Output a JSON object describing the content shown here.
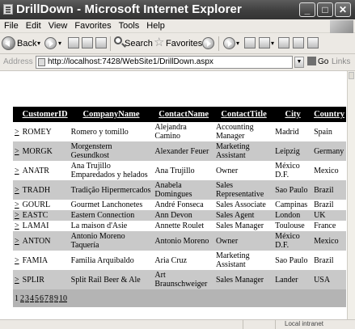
{
  "window": {
    "title": "DrillDown - Microsoft Internet Explorer"
  },
  "menu": [
    "File",
    "Edit",
    "View",
    "Favorites",
    "Tools",
    "Help"
  ],
  "toolbar": {
    "back_label": "Back",
    "search_label": "Search",
    "favorites_label": "Favorites"
  },
  "address": {
    "label": "Address",
    "url": "http://localhost:7428/WebSite1/DrillDown.aspx",
    "go_label": "Go",
    "links_label": "Links"
  },
  "status": {
    "zone": "Local intranet"
  },
  "grid": {
    "columns": [
      "CustomerID",
      "CompanyName",
      "ContactName",
      "ContactTitle",
      "City",
      "Country"
    ],
    "select_glyph": ">",
    "rows": [
      {
        "id": "ROMEY",
        "company": "Romero y tomillo",
        "contact": "Alejandra Camino",
        "title": "Accounting Manager",
        "city": "Madrid",
        "country": "Spain"
      },
      {
        "id": "MORGK",
        "company": "Morgenstern Gesundkost",
        "contact": "Alexander Feuer",
        "title": "Marketing Assistant",
        "city": "Leipzig",
        "country": "Germany"
      },
      {
        "id": "ANATR",
        "company": "Ana Trujillo Emparedados y helados",
        "contact": "Ana Trujillo",
        "title": "Owner",
        "city": "México D.F.",
        "country": "Mexico"
      },
      {
        "id": "TRADH",
        "company": "Tradição Hipermercados",
        "contact": "Anabela Domingues",
        "title": "Sales Representative",
        "city": "Sao Paulo",
        "country": "Brazil"
      },
      {
        "id": "GOURL",
        "company": "Gourmet Lanchonetes",
        "contact": "André Fonseca",
        "title": "Sales Associate",
        "city": "Campinas",
        "country": "Brazil"
      },
      {
        "id": "EASTC",
        "company": "Eastern Connection",
        "contact": "Ann Devon",
        "title": "Sales Agent",
        "city": "London",
        "country": "UK"
      },
      {
        "id": "LAMAI",
        "company": "La maison d'Asie",
        "contact": "Annette Roulet",
        "title": "Sales Manager",
        "city": "Toulouse",
        "country": "France"
      },
      {
        "id": "ANTON",
        "company": "Antonio Moreno Taquería",
        "contact": "Antonio Moreno",
        "title": "Owner",
        "city": "México D.F.",
        "country": "Mexico"
      },
      {
        "id": "FAMIA",
        "company": "Familia Arquibaldo",
        "contact": "Aria Cruz",
        "title": "Marketing Assistant",
        "city": "Sao Paulo",
        "country": "Brazil"
      },
      {
        "id": "SPLIR",
        "company": "Split Rail Beer & Ale",
        "contact": "Art Braunschweiger",
        "title": "Sales Manager",
        "city": "Lander",
        "country": "USA"
      }
    ],
    "pager": {
      "current": "1",
      "pages": [
        "2",
        "3",
        "4",
        "5",
        "6",
        "7",
        "8",
        "9",
        "10"
      ]
    }
  }
}
